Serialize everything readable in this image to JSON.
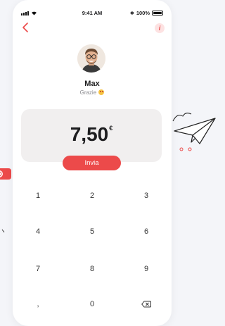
{
  "status_bar": {
    "time": "9:41 AM",
    "battery": "100%"
  },
  "nav": {
    "back_icon": "chevron-left-icon",
    "info_label": "i"
  },
  "recipient": {
    "name": "Max",
    "status": "Grazie"
  },
  "amount": {
    "value": "7,50",
    "currency": "€"
  },
  "send_button": {
    "label": "Invia"
  },
  "keypad": {
    "keys": [
      "1",
      "2",
      "3",
      "4",
      "5",
      "6",
      "7",
      "8",
      "9",
      ",",
      "0"
    ],
    "delete_icon": "backspace-icon"
  },
  "colors": {
    "accent": "#ec4a4a",
    "amount_bg": "#f1efef",
    "page_bg": "#f4f5f9"
  }
}
